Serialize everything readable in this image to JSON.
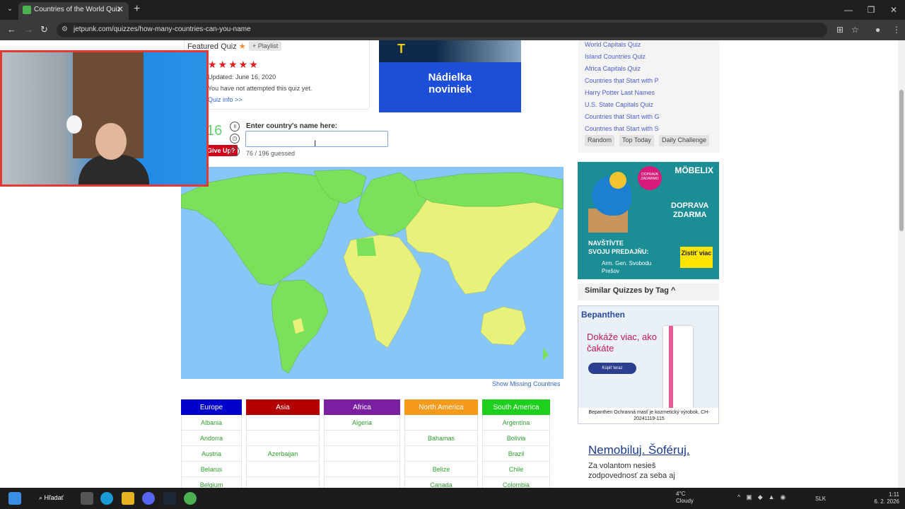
{
  "browser": {
    "tab_title": "Countries of the World Quiz",
    "url": "jetpunk.com/quizzes/how-many-countries-can-you-name",
    "tab_close": "✕",
    "new_tab": "+"
  },
  "quiz_info": {
    "featured": "Featured Quiz",
    "playlist": "+ Playlist",
    "stars": "★★★★★",
    "updated": "Updated: June 16, 2020",
    "attempted": "You have not attempted this quiz yet.",
    "quiz_info_link": "Quiz info >>"
  },
  "ad_top": {
    "headline1": "Nádielka",
    "headline2": "noviniek"
  },
  "quiz": {
    "timer": "16",
    "give_up": "Give Up?",
    "enter_label": "Enter country's name here:",
    "answer_value": "",
    "guessed": "76 / 196 guessed",
    "show_missing": "Show Missing Countries"
  },
  "continents": {
    "headers": [
      {
        "label": "Europe",
        "color": "#0000cc"
      },
      {
        "label": "Asia",
        "color": "#b30000"
      },
      {
        "label": "Africa",
        "color": "#7b1fa2"
      },
      {
        "label": "North America",
        "color": "#f59a1b"
      },
      {
        "label": "South America",
        "color": "#1ecf1e"
      }
    ],
    "rows": [
      [
        "Albania",
        "",
        "Algeria",
        "",
        "Argentina"
      ],
      [
        "Andorra",
        "",
        "",
        "Bahamas",
        "Bolivia"
      ],
      [
        "Austria",
        "Azerbaijan",
        "",
        "",
        "Brazil"
      ],
      [
        "Belarus",
        "",
        "",
        "Belize",
        "Chile"
      ],
      [
        "Belgium",
        "",
        "",
        "Canada",
        "Colombia"
      ]
    ]
  },
  "sidebar": {
    "links": [
      "World Capitals Quiz",
      "Island Countries Quiz",
      "Africa Capitals Quiz",
      "Countries that Start with P",
      "Harry Potter Last Names",
      "U.S. State Capitals Quiz",
      "Countries that Start with G",
      "Countries that Start with S"
    ],
    "chips": [
      "Random",
      "Top Today",
      "Daily Challenge"
    ],
    "similar_title": "Similar Quizzes by Tag ^"
  },
  "ad_mobelix": {
    "logo": "MÖBELIX",
    "badge": "DOPRAVA ZADARMO",
    "dob": "DOPRAVA\nZDARMA",
    "nav": "NAVŠTÍVTE\nSVOJU PREDAJŇU:",
    "addr": "Arm. Gen. Svobodu\nPrešov",
    "btn": "Zistiť viac"
  },
  "ad_bepanthen": {
    "logo": "Bepanthen",
    "headline": "Dokáže viac, ako čakáte",
    "btn": "Kúpiť teraz",
    "foot": "Bepanthen Ochranná masť je kozmetický výrobok. CH-20241119-115"
  },
  "ad_text": {
    "headline": "Nemobiluj. Šoféruj.",
    "body": "Za volantom nesieš zodpovednosť za seba aj"
  },
  "taskbar": {
    "search": "Hľadať",
    "temp": "4°C",
    "weather": "Cloudy",
    "lang": "SLK",
    "time": "1:11",
    "date": "6. 2. 2026"
  }
}
